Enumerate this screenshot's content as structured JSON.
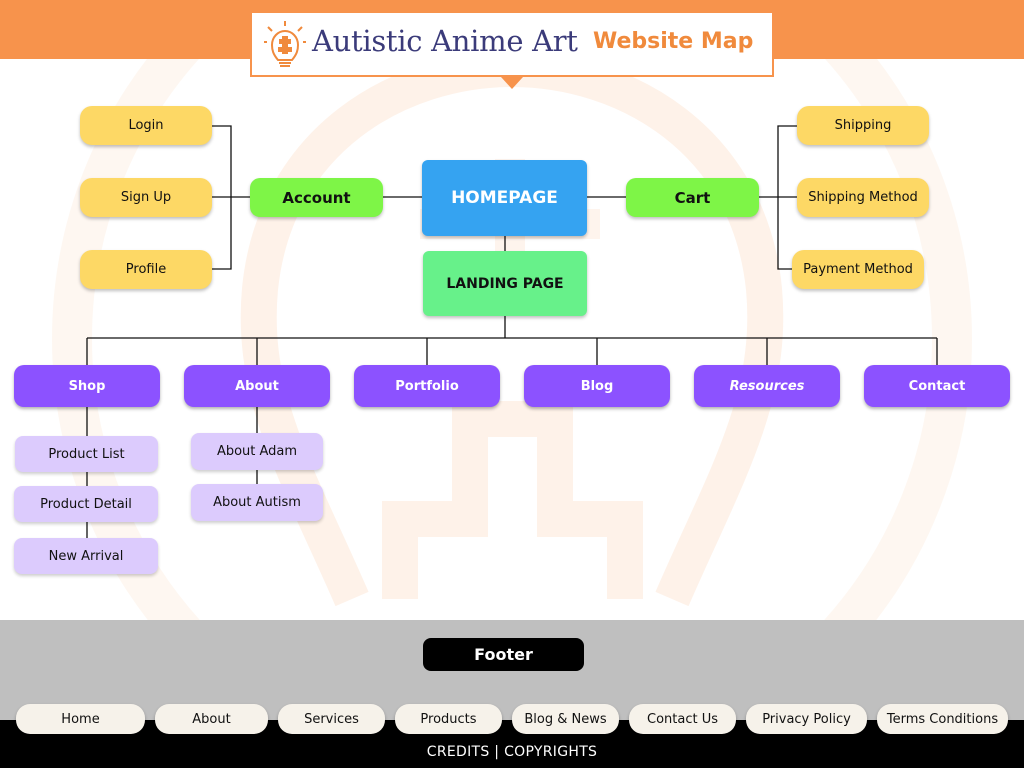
{
  "header": {
    "site_name": "Autistic Anime Art",
    "map_label": "Website Map"
  },
  "colors": {
    "orange": "#f7934c",
    "navy": "#3b3b7a",
    "yellow": "#fdd865",
    "green": "#7ef547",
    "blue": "#35a3f1",
    "mint": "#67f18a",
    "purple": "#8c52ff",
    "lavender": "#dccbfd",
    "footer_gray": "#bfbfbf"
  },
  "diagram": {
    "homepage": "HOMEPAGE",
    "landing": "LANDING PAGE",
    "account": {
      "label": "Account",
      "children": [
        "Login",
        "Sign Up",
        "Profile"
      ]
    },
    "cart": {
      "label": "Cart",
      "children": [
        "Shipping",
        "Shipping Method",
        "Payment Method"
      ]
    },
    "sections": [
      {
        "label": "Shop",
        "children": [
          "Product List",
          "Product Detail",
          "New Arrival"
        ]
      },
      {
        "label": "About",
        "children": [
          "About Adam",
          "About Autism"
        ]
      },
      {
        "label": "Portfolio",
        "children": []
      },
      {
        "label": "Blog",
        "children": []
      },
      {
        "label": "Resources",
        "children": []
      },
      {
        "label": "Contact",
        "children": []
      }
    ]
  },
  "footer": {
    "label": "Footer",
    "links": [
      "Home",
      "About",
      "Services",
      "Products",
      "Blog & News",
      "Contact Us",
      "Privacy Policy",
      "Terms Conditions"
    ],
    "credits": "CREDITS | COPYRIGHTS"
  }
}
